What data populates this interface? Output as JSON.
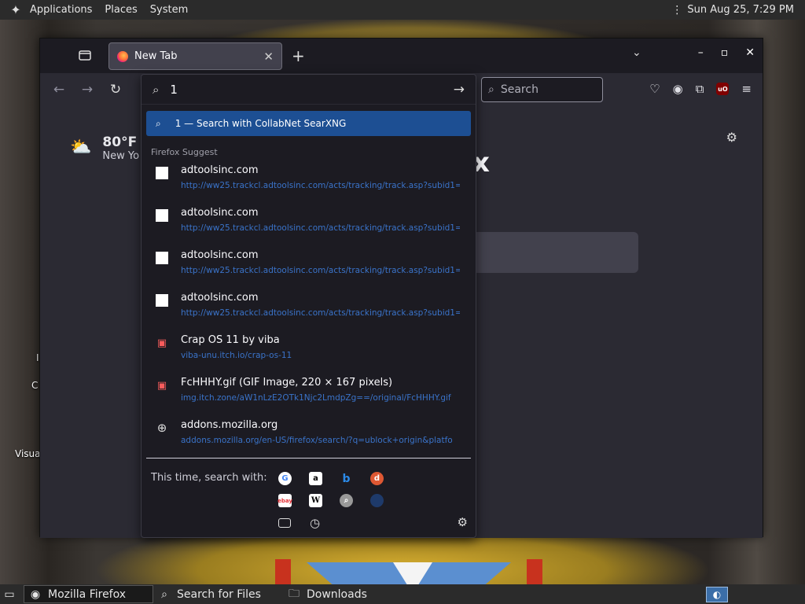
{
  "top_panel": {
    "menus": [
      "Applications",
      "Places",
      "System"
    ],
    "clock": "Sun Aug 25,  7:29 PM"
  },
  "browser": {
    "tab": {
      "title": "New Tab"
    },
    "search_placeholder": "Search",
    "new_tab_page": {
      "weather_temp": "80°F",
      "weather_location": "New Yo",
      "brand_partial": "x"
    }
  },
  "urlbar": {
    "typed": "1",
    "heuristic": "1 — Search with CollabNet SearXNG",
    "section_label": "Firefox Suggest",
    "results": [
      {
        "icon": "blank-page-icon",
        "title": "adtoolsinc.com",
        "url": "http://ww25.trackcl.adtoolsinc.com/acts/tracking/track.asp?subid1="
      },
      {
        "icon": "blank-page-icon",
        "title": "adtoolsinc.com",
        "url": "http://ww25.trackcl.adtoolsinc.com/acts/tracking/track.asp?subid1="
      },
      {
        "icon": "blank-page-icon",
        "title": "adtoolsinc.com",
        "url": "http://ww25.trackcl.adtoolsinc.com/acts/tracking/track.asp?subid1="
      },
      {
        "icon": "blank-page-icon",
        "title": "adtoolsinc.com",
        "url": "http://ww25.trackcl.adtoolsinc.com/acts/tracking/track.asp?subid1="
      },
      {
        "icon": "itch-icon",
        "title": "Crap OS 11 by viba",
        "url": "viba-unu.itch.io/crap-os-11"
      },
      {
        "icon": "itch-icon",
        "title": "FcHHHY.gif (GIF Image, 220 × 167 pixels)",
        "url": "img.itch.zone/aW1nLzE2OTk1Njc2LmdpZg==/original/FcHHHY.gif"
      },
      {
        "icon": "globe-icon",
        "title": "addons.mozilla.org",
        "url": "addons.mozilla.org/en-US/firefox/search/?q=ublock+origin&platfo"
      }
    ],
    "oneoff_label": "This time, search with:"
  },
  "desktop": {
    "labels": [
      "I",
      "C",
      "Visua"
    ]
  },
  "taskbar": {
    "items": [
      "Mozilla Firefox",
      "Search for Files",
      "Downloads"
    ]
  }
}
